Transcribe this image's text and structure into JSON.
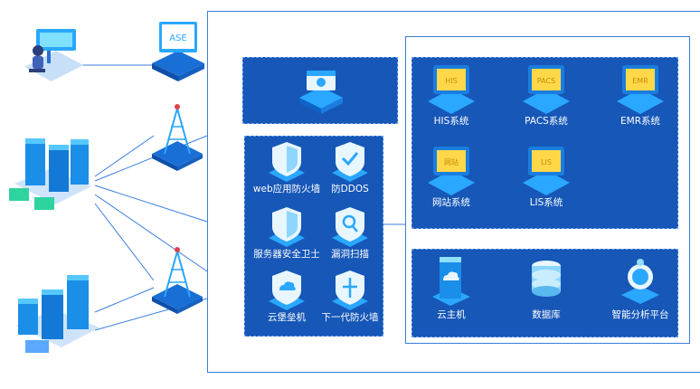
{
  "colors": {
    "panel": "#1657b8",
    "frame": "#3a7ee0",
    "line": "#3a7ee0",
    "iconCyan": "#2fd3ff",
    "iconLight": "#9fe8ff",
    "monitorYellow": "#ffd84a"
  },
  "left_devices": [
    {
      "icon": "person-at-desk-icon"
    },
    {
      "icon": "server-rack-cluster-icon"
    },
    {
      "icon": "server-rack-cluster-icon"
    }
  ],
  "middle_devices": [
    {
      "icon": "cloud-monitor-icon",
      "screen_text": "ASE"
    },
    {
      "icon": "signal-tower-icon"
    },
    {
      "icon": "signal-tower-icon"
    }
  ],
  "gateway": {
    "icon": "gateway-device-icon"
  },
  "security": {
    "items": [
      {
        "label": "web应用防火墙",
        "icon": "shield-icon"
      },
      {
        "label": "防DDOS",
        "icon": "shield-check-icon"
      },
      {
        "label": "服务器安全卫士",
        "icon": "shield-icon"
      },
      {
        "label": "漏洞扫描",
        "icon": "shield-search-icon"
      },
      {
        "label": "云堡垒机",
        "icon": "shield-cloud-icon"
      },
      {
        "label": "下一代防火墙",
        "icon": "shield-fire-icon"
      }
    ]
  },
  "systems": {
    "items": [
      {
        "label": "HIS系统",
        "screen": "HIS"
      },
      {
        "label": "PACS系统",
        "screen": "PACS"
      },
      {
        "label": "EMR系统",
        "screen": "EMR"
      },
      {
        "label": "网站系统",
        "screen": "网站"
      },
      {
        "label": "LIS系统",
        "screen": "LIS"
      }
    ]
  },
  "infra": {
    "items": [
      {
        "label": "云主机",
        "icon": "cloud-host-icon"
      },
      {
        "label": "数据库",
        "icon": "database-icon"
      },
      {
        "label": "智能分析平台",
        "icon": "ai-platform-icon"
      }
    ]
  }
}
